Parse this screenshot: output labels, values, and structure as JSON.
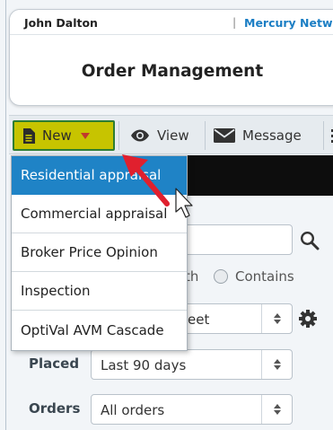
{
  "header": {
    "user_name": "John Dalton",
    "separator": "|",
    "brand": "Mercury Netw",
    "title": "Order Management"
  },
  "toolbar": {
    "new_label": "New",
    "view_label": "View",
    "message_label": "Message"
  },
  "new_menu": {
    "items": [
      {
        "label": "Residential appraisal",
        "active": true
      },
      {
        "label": "Commercial appraisal",
        "active": false
      },
      {
        "label": "Broker Price Opinion",
        "active": false
      },
      {
        "label": "Inspection",
        "active": false
      },
      {
        "label": "OptiVal AVM Cascade",
        "active": false
      }
    ]
  },
  "search": {
    "match_partial": "th",
    "contains_label": "Contains"
  },
  "filters": {
    "view_select_partial": "eet",
    "placed_label": "Placed",
    "placed_value": "Last 90 days",
    "orders_label": "Orders",
    "orders_value": "All orders"
  },
  "colors": {
    "new_button_bg": "#c7c400",
    "new_button_border": "#2e7d32",
    "menu_active_bg": "#1f83c6",
    "brand_text": "#1b7ec4",
    "annotation_arrow": "#e0202e"
  }
}
